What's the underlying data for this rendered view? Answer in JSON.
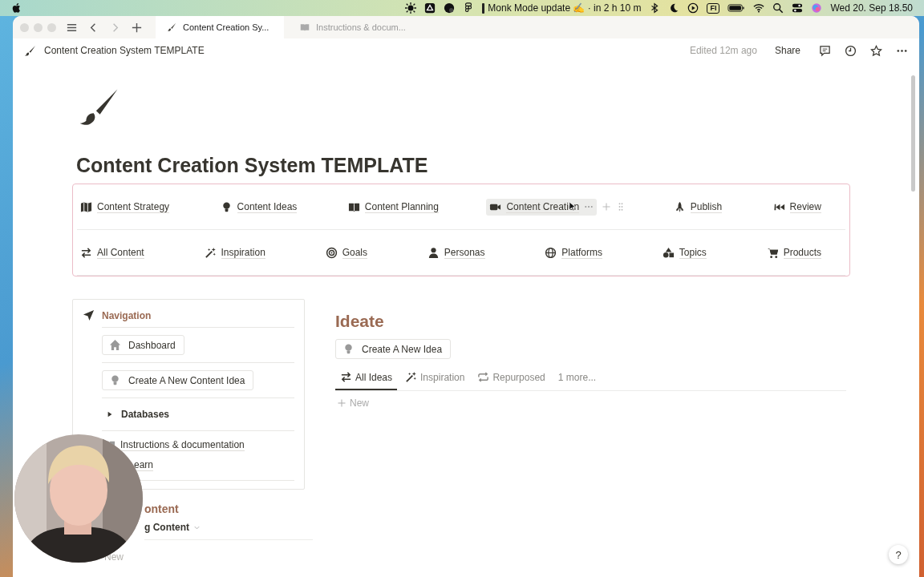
{
  "menu_bar": {
    "focus_event": "Monk Mode update ✍ · in 2 h 10 m",
    "input_badge": "FI",
    "clock": "Wed 20. Sep  18.50"
  },
  "browser": {
    "tabs": [
      {
        "label": "Content Creation Sy...",
        "selected": true
      },
      {
        "label": "Instructions & docum...",
        "selected": false
      }
    ]
  },
  "topbar": {
    "breadcrumb": "Content Creation System TEMPLATE",
    "edited": "Edited 12m ago",
    "share": "Share"
  },
  "page": {
    "title": "Content Creation System TEMPLATE"
  },
  "nav_links": [
    [
      {
        "label": "Content Strategy",
        "selected": false
      },
      {
        "label": "Content Ideas",
        "selected": false
      },
      {
        "label": "Content Planning",
        "selected": false
      },
      {
        "label": "Content Creation",
        "selected": true
      },
      {
        "label": "Publish",
        "selected": false
      },
      {
        "label": "Review",
        "selected": false
      }
    ],
    [
      {
        "label": "All Content",
        "selected": false
      },
      {
        "label": "Inspiration",
        "selected": false
      },
      {
        "label": "Goals",
        "selected": false
      },
      {
        "label": "Personas",
        "selected": false
      },
      {
        "label": "Platforms",
        "selected": false
      },
      {
        "label": "Topics",
        "selected": false
      },
      {
        "label": "Products",
        "selected": false
      }
    ]
  ],
  "navigation": {
    "heading": "Navigation",
    "buttons": [
      "Dashboard",
      "Create A New Content Idea"
    ],
    "toggle": {
      "label": "Databases",
      "expanded": false
    },
    "links": [
      "Instructions & documentation",
      "earn"
    ]
  },
  "below_nav": {
    "heading": "ontent",
    "view": "g Content",
    "new": "New"
  },
  "ideate": {
    "heading": "Ideate",
    "button": "Create A New Idea",
    "views": [
      {
        "label": "All Ideas",
        "selected": true
      },
      {
        "label": "Inspiration",
        "selected": false
      },
      {
        "label": "Repurposed",
        "selected": false
      }
    ],
    "more": "1 more...",
    "new": "New"
  },
  "help": "?"
}
